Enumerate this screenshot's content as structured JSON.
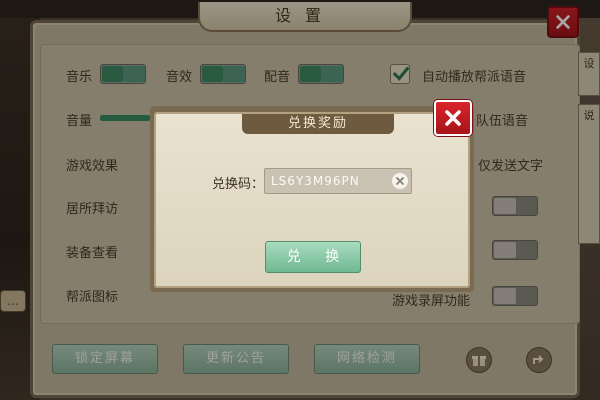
{
  "settings": {
    "title": "设置",
    "rows": {
      "music": "音乐",
      "sound_fx": "音效",
      "voice": "配音",
      "auto_play_voice": "自动播放帮派语音",
      "volume": "音量",
      "team_voice": "队伍语音",
      "game_effects": "游戏效果",
      "send_text_only": "仅发送文字",
      "home_visit": "居所拜访",
      "equip_view": "装备查看",
      "guild_icon": "帮派图标",
      "screen_record": "游戏录屏功能"
    },
    "toggles": {
      "music": "on",
      "sound_fx": "on",
      "voice": "on"
    },
    "volume_level": 0.35,
    "bottom_buttons": [
      "锁定屏幕",
      "更新公告",
      "网络检测"
    ]
  },
  "redeem_dialog": {
    "title": "兑换奖励",
    "code_label": "兑换码：",
    "code_value": "LS6Y3M96PN",
    "redeem_button": "兑 换"
  },
  "right_tabs": [
    "设",
    "说"
  ],
  "icons": {
    "close": "close-icon",
    "checkmark": "checkmark-icon",
    "clear": "clear-icon",
    "share": "share-icon",
    "gift": "gift-icon"
  },
  "colors": {
    "accent_green": "#3f8a63",
    "close_red": "#c41d24",
    "panel_bg": "#c4b89d"
  }
}
